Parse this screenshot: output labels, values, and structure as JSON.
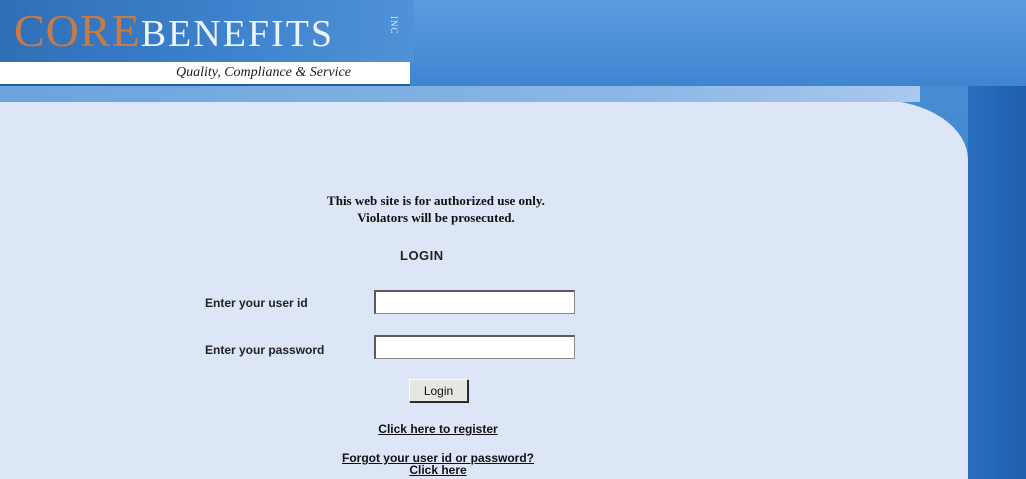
{
  "header": {
    "logo_core": "CORE",
    "logo_benefits": "BENEFITS",
    "logo_inc": "INC",
    "tagline": "Quality, Compliance & Service"
  },
  "notice": {
    "line1": "This web site is for authorized use only.",
    "line2": "Violators will be prosecuted."
  },
  "login": {
    "title": "LOGIN",
    "user_label": "Enter your user id",
    "user_value": "",
    "password_label": "Enter your password",
    "password_value": "",
    "button_label": "Login"
  },
  "links": {
    "register": "Click here to register",
    "forgot_line1": "Forgot your user id or password?",
    "forgot_line2": "Click here"
  },
  "colors": {
    "background_blue": "#3f86cf",
    "panel": "#dce6f6",
    "logo_core": "#c97a45"
  }
}
